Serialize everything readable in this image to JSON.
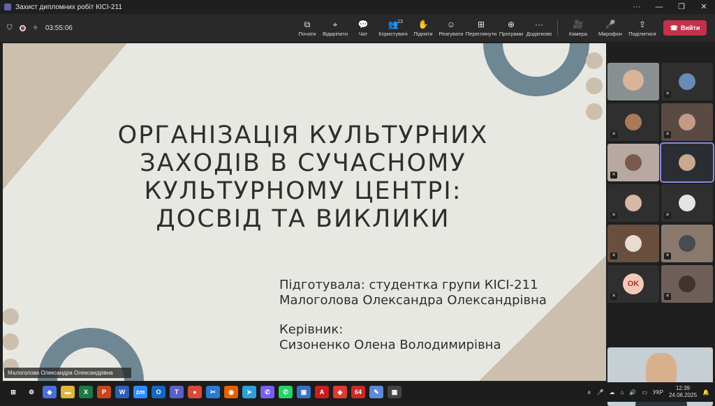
{
  "window": {
    "title": "Захист дипломних робіт КІСІ-211",
    "controls": [
      "···",
      "—",
      "❐",
      "✕"
    ]
  },
  "meeting": {
    "timer": "03:55:06",
    "tools": [
      {
        "id": "start",
        "label": "Почати",
        "icon": "screen-share-icon",
        "glyph": "⧉"
      },
      {
        "id": "unpin",
        "label": "Відкріпити",
        "icon": "unpin-icon",
        "glyph": "⌖"
      },
      {
        "id": "chat",
        "label": "Чат",
        "icon": "chat-icon",
        "glyph": "💬"
      },
      {
        "id": "people",
        "label": "Користувачі",
        "icon": "people-icon",
        "glyph": "👥",
        "count": "13"
      },
      {
        "id": "raise",
        "label": "Підняти",
        "icon": "raise-hand-icon",
        "glyph": "✋"
      },
      {
        "id": "react",
        "label": "Реагувати",
        "icon": "smiley-icon",
        "glyph": "☺"
      },
      {
        "id": "view",
        "label": "Переглянути",
        "icon": "view-icon",
        "glyph": "⊞"
      },
      {
        "id": "apps",
        "label": "Програми",
        "icon": "apps-icon",
        "glyph": "⊕"
      },
      {
        "id": "more",
        "label": "Додатково",
        "icon": "more-icon",
        "glyph": "···"
      },
      {
        "id": "camera",
        "label": "Камера",
        "icon": "camera-icon",
        "glyph": "🎥"
      },
      {
        "id": "mic",
        "label": "Мікрофон",
        "icon": "microphone-icon",
        "glyph": "🎤"
      },
      {
        "id": "share",
        "label": "Поділитися",
        "icon": "share-icon",
        "glyph": "⇪"
      }
    ],
    "leave_label": "Вийти"
  },
  "slide": {
    "title": "ОРГАНІЗАЦІЯ КУЛЬТУРНИХ ЗАХОДІВ В СУЧАСНОМУ КУЛЬТУРНОМУ ЦЕНТРІ: ДОСВІД ТА ВИКЛИКИ",
    "prepared_by": "Підготувала: студентка групи КІСІ-211",
    "student": "Малоголова Олександра Олександрівна",
    "supervisor_label": "Керівник:",
    "supervisor": "Сизоненко Олена Володимирівна",
    "colors": {
      "slate": "#6f8693",
      "beige": "#cdbfad",
      "bg": "#e8e8e3"
    }
  },
  "presenter_tag": "Малоголова Олександра Олександрівна",
  "gallery": {
    "ok_initials": "OK"
  },
  "taskbar": {
    "apps": [
      {
        "name": "windows-start-icon",
        "glyph": "⊞",
        "color": "#1c1c1c"
      },
      {
        "name": "settings-icon",
        "glyph": "⚙",
        "color": "#1c1c1c"
      },
      {
        "name": "copilot-icon",
        "glyph": "◆",
        "color": "#4a6fd8"
      },
      {
        "name": "file-explorer-icon",
        "glyph": "▬",
        "color": "#e0b53a"
      },
      {
        "name": "excel-icon",
        "glyph": "X",
        "color": "#1d7a45"
      },
      {
        "name": "powerpoint-icon",
        "glyph": "P",
        "color": "#c4461f"
      },
      {
        "name": "word-icon",
        "glyph": "W",
        "color": "#2b5eb5"
      },
      {
        "name": "zoom-icon",
        "glyph": "zm",
        "color": "#2d8cff"
      },
      {
        "name": "outlook-icon",
        "glyph": "O",
        "color": "#1466c0"
      },
      {
        "name": "teams-icon",
        "glyph": "T",
        "color": "#5b5fc7"
      },
      {
        "name": "chrome-icon",
        "glyph": "●",
        "color": "#d94a3a"
      },
      {
        "name": "snipping-tool-icon",
        "glyph": "✂",
        "color": "#2a7ad3"
      },
      {
        "name": "firefox-icon",
        "glyph": "◉",
        "color": "#e66000"
      },
      {
        "name": "telegram-icon",
        "glyph": "➤",
        "color": "#2aa1da"
      },
      {
        "name": "viber-icon",
        "glyph": "✆",
        "color": "#7360f2"
      },
      {
        "name": "whatsapp-icon",
        "glyph": "✆",
        "color": "#25d366"
      },
      {
        "name": "save-icon",
        "glyph": "▣",
        "color": "#3a6fc8"
      },
      {
        "name": "acrobat-icon",
        "glyph": "A",
        "color": "#c81e1e"
      },
      {
        "name": "anydesk-icon",
        "glyph": "◈",
        "color": "#e03a2f"
      },
      {
        "name": "app-64-icon",
        "glyph": "64",
        "color": "#c82a2a"
      },
      {
        "name": "paint-icon",
        "glyph": "✎",
        "color": "#5a8ad8"
      },
      {
        "name": "calculator-icon",
        "glyph": "▦",
        "color": "#444"
      }
    ],
    "lang": "УКР",
    "time": "12:39",
    "date": "24.06.2025"
  }
}
